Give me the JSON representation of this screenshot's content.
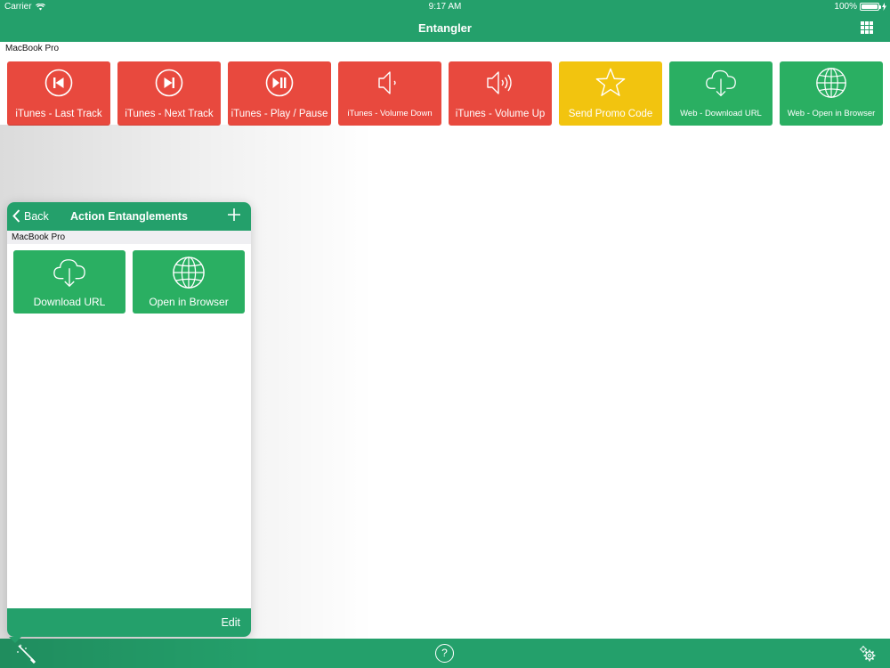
{
  "status_bar": {
    "carrier": "Carrier",
    "time": "9:17 AM",
    "battery": "100%",
    "battery_level": 1.0
  },
  "app": {
    "title": "Entangler"
  },
  "main": {
    "section_label": "MacBook Pro",
    "tiles": [
      {
        "label": "iTunes - Last Track",
        "color": "#e8493e",
        "icon": "previous-track-icon"
      },
      {
        "label": "iTunes - Next Track",
        "color": "#e8493e",
        "icon": "next-track-icon"
      },
      {
        "label": "iTunes - Play / Pause",
        "color": "#e8493e",
        "icon": "play-pause-icon"
      },
      {
        "label": "iTunes - Volume Down",
        "color": "#e8493e",
        "icon": "volume-down-icon"
      },
      {
        "label": "iTunes - Volume Up",
        "color": "#e8493e",
        "icon": "volume-up-icon"
      },
      {
        "label": "Send Promo Code",
        "color": "#f2c40f",
        "icon": "star-icon"
      },
      {
        "label": "Web - Download URL",
        "color": "#2aaf62",
        "icon": "cloud-download-icon"
      },
      {
        "label": "Web - Open in Browser",
        "color": "#2aaf62",
        "icon": "globe-icon"
      }
    ]
  },
  "popover": {
    "back_label": "Back",
    "title": "Action Entanglements",
    "section_label": "MacBook Pro",
    "tiles": [
      {
        "label": "Download URL",
        "icon": "cloud-download-icon"
      },
      {
        "label": "Open in Browser",
        "icon": "globe-icon"
      }
    ],
    "edit_label": "Edit"
  },
  "bottom_bar": {
    "help_label": "?"
  },
  "colors": {
    "brand_green": "#24a06b",
    "tile_red": "#e8493e",
    "tile_yellow": "#f2c40f",
    "tile_green": "#2aaf62"
  }
}
